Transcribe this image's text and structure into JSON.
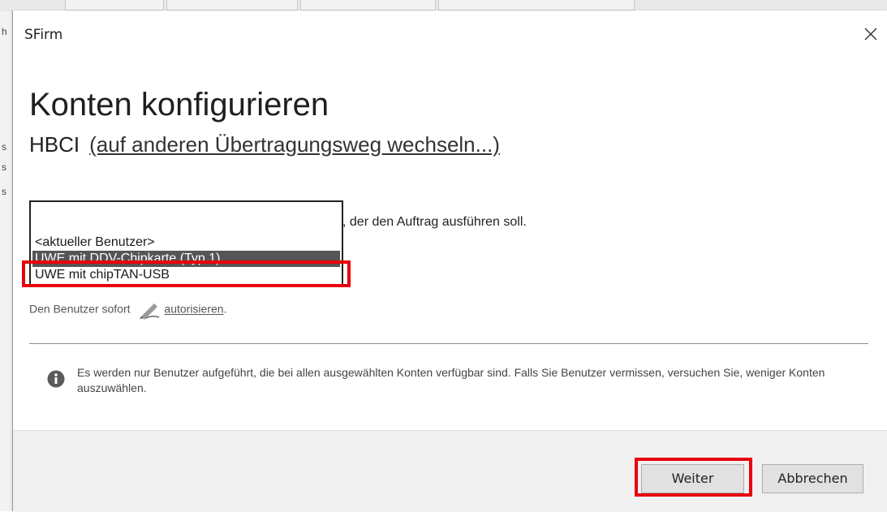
{
  "window": {
    "title": "SFirm"
  },
  "header": {
    "title": "Konten konfigurieren",
    "transport": "HBCI",
    "change_link": "(auf anderen Übertragungsweg wechseln...)"
  },
  "user_select": {
    "instruction_visible": "s, der den Auftrag ausführen soll.",
    "options": [
      {
        "label": "<aktueller Benutzer>"
      },
      {
        "label": "UWE mit DDV-Chipkarte (Typ 1)",
        "selected": true
      },
      {
        "label": "UWE mit chipTAN-USB"
      }
    ]
  },
  "authorize": {
    "text": "Den Benutzer sofort",
    "link": "autorisieren",
    "suffix": "."
  },
  "info": {
    "text": "Es werden nur Benutzer aufgeführt, die bei allen ausgewählten Konten verfügbar sind. Falls Sie Benutzer vermissen, versuchen Sie, weniger Konten auszuwählen."
  },
  "buttons": {
    "next": "Weiter",
    "cancel": "Abbrechen"
  },
  "colors": {
    "highlight": "#e8000b",
    "selected_bg": "#555555",
    "footer_bg": "#f0f0f0"
  }
}
